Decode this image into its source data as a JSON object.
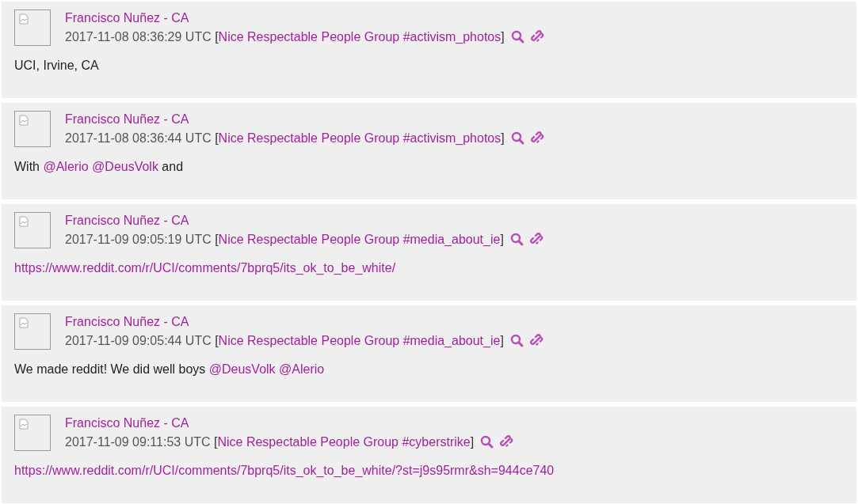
{
  "posts": [
    {
      "author": "Francisco Nuñez - CA",
      "timestamp": "2017-11-08 08:36:29 UTC",
      "open": "[",
      "channel": "Nice Respectable People Group #activism_photos",
      "close": "]",
      "body": [
        {
          "kind": "text",
          "text": "UCI, Irvine, CA"
        }
      ]
    },
    {
      "author": "Francisco Nuñez - CA",
      "timestamp": "2017-11-08 08:36:44 UTC",
      "open": "[",
      "channel": "Nice Respectable People Group #activism_photos",
      "close": "]",
      "body": [
        {
          "kind": "text",
          "text": "With "
        },
        {
          "kind": "mention",
          "text": "@Alerio"
        },
        {
          "kind": "mention",
          "text": "@DeusVolk"
        },
        {
          "kind": "text",
          "text": " and"
        }
      ]
    },
    {
      "author": "Francisco Nuñez - CA",
      "timestamp": "2017-11-09 09:05:19 UTC",
      "open": "[",
      "channel": "Nice Respectable People Group #media_about_ie",
      "close": "]",
      "body": [
        {
          "kind": "link",
          "text": "https://www.reddit.com/r/UCI/comments/7bprq5/its_ok_to_be_white/"
        }
      ]
    },
    {
      "author": "Francisco Nuñez - CA",
      "timestamp": "2017-11-09 09:05:44 UTC",
      "open": "[",
      "channel": "Nice Respectable People Group #media_about_ie",
      "close": "]",
      "body": [
        {
          "kind": "text",
          "text": "We made reddit! We did well boys "
        },
        {
          "kind": "mention",
          "text": "@DeusVolk"
        },
        {
          "kind": "mention",
          "text": "@Alerio"
        }
      ]
    },
    {
      "author": "Francisco Nuñez - CA",
      "timestamp": "2017-11-09 09:11:53 UTC",
      "open": "[",
      "channel": "Nice Respectable People Group #cyberstrike",
      "close": "]",
      "body": [
        {
          "kind": "link",
          "text": "https://www.reddit.com/r/UCI/comments/7bprq5/its_ok_to_be_white/?st=j9s95rmr&sh=944ce740"
        }
      ]
    }
  ]
}
